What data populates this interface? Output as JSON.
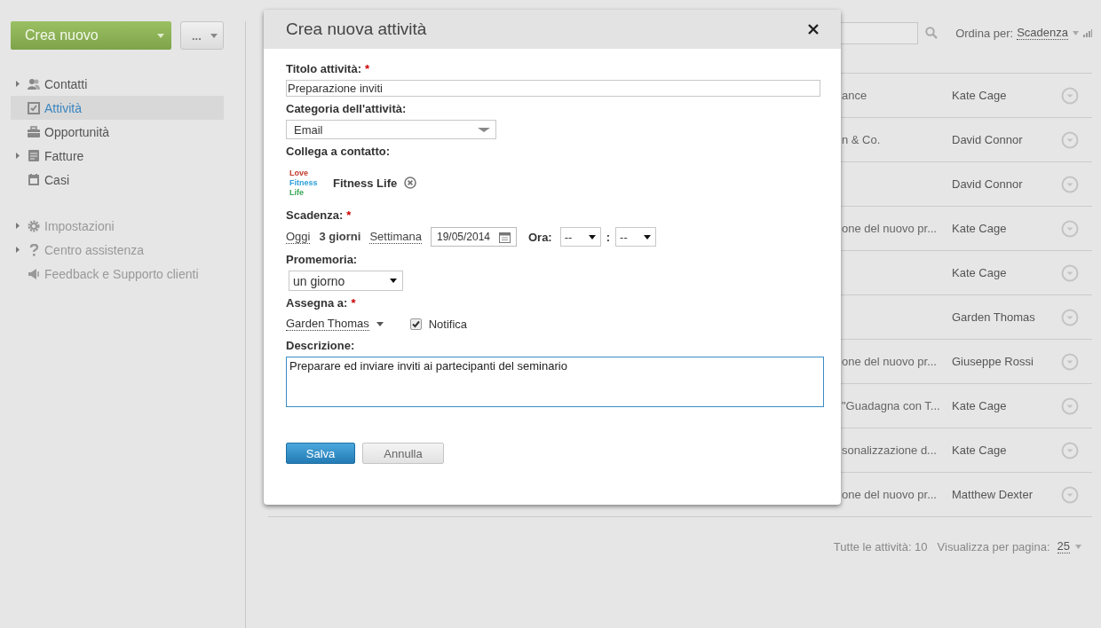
{
  "sidebar": {
    "create_button": {
      "label": "Crea nuovo"
    },
    "more_button": {
      "label": "..."
    },
    "nav_groups": [
      {
        "kind": "primary",
        "items": [
          {
            "label": "Contatti",
            "has_children": true,
            "selected": false
          },
          {
            "label": "Attività",
            "has_children": false,
            "selected": true
          },
          {
            "label": "Opportunità",
            "has_children": false,
            "selected": false
          },
          {
            "label": "Fatture",
            "has_children": true,
            "selected": false
          },
          {
            "label": "Casi",
            "has_children": false,
            "selected": false
          }
        ]
      },
      {
        "kind": "secondary",
        "items": [
          {
            "label": "Impostazioni",
            "has_children": true,
            "selected": false
          },
          {
            "label": "Centro assistenza",
            "has_children": true,
            "selected": false
          },
          {
            "label": "Feedback e Supporto clienti",
            "has_children": false,
            "selected": false
          }
        ]
      }
    ]
  },
  "toolbar": {
    "sort_label": "Ordina per:",
    "sort_value": "Scadenza"
  },
  "list": {
    "rows": [
      {
        "subject": "ance",
        "owner": "Kate Cage"
      },
      {
        "subject": "n & Co.",
        "owner": "David Connor"
      },
      {
        "owner": "David Connor"
      },
      {
        "subject": "one del nuovo pr...",
        "owner": "Kate Cage"
      },
      {
        "owner": "Kate Cage"
      },
      {
        "owner": "Garden Thomas"
      },
      {
        "subject": "one del nuovo pr...",
        "owner": "Giuseppe Rossi"
      },
      {
        "subject": "\"Guadagna con T...",
        "owner": "Kate Cage"
      },
      {
        "subject": "sonalizzazione d...",
        "owner": "Kate Cage"
      },
      {
        "subject": "one del nuovo pr...",
        "owner": "Matthew Dexter"
      }
    ]
  },
  "footer": {
    "total": "Tutte le attività: 10",
    "per_page_label": "Visualizza per pagina:",
    "per_page_value": "25"
  },
  "dialog": {
    "title": "Crea nuova attività",
    "title_field": {
      "label": "Titolo attività:",
      "required_mark": "*",
      "value": "Preparazione inviti"
    },
    "category_field": {
      "label": "Categoria dell'attività:",
      "value": "Email"
    },
    "contact_field": {
      "label": "Collega a contatto:",
      "logo_lines": [
        {
          "text": "Love",
          "color": "#c0392b"
        },
        {
          "text": "Fitness",
          "color": "#2e9fd8"
        },
        {
          "text": "Life",
          "color": "#3aa655"
        }
      ],
      "contact_name": "Fitness Life"
    },
    "due_field": {
      "label": "Scadenza:",
      "required_mark": "*",
      "quick_options": [
        {
          "label": "Oggi",
          "selected": false
        },
        {
          "label": "3 giorni",
          "selected": true
        },
        {
          "label": "Settimana",
          "selected": false
        }
      ],
      "date": "19/05/2014",
      "time_label": "Ora:",
      "hour": "--",
      "separator": ":",
      "minute": "--"
    },
    "reminder_field": {
      "label": "Promemoria:",
      "value": "un giorno"
    },
    "assign_field": {
      "label": "Assegna a:",
      "required_mark": "*",
      "value": "Garden Thomas",
      "notify": {
        "label": "Notifica",
        "checked": true
      }
    },
    "description_field": {
      "label": "Descrizione:",
      "value": "Preparare ed inviare inviti ai partecipanti del seminario"
    },
    "buttons": [
      {
        "label": "Salva",
        "kind": "primary"
      },
      {
        "label": "Annulla",
        "kind": "secondary"
      }
    ]
  }
}
